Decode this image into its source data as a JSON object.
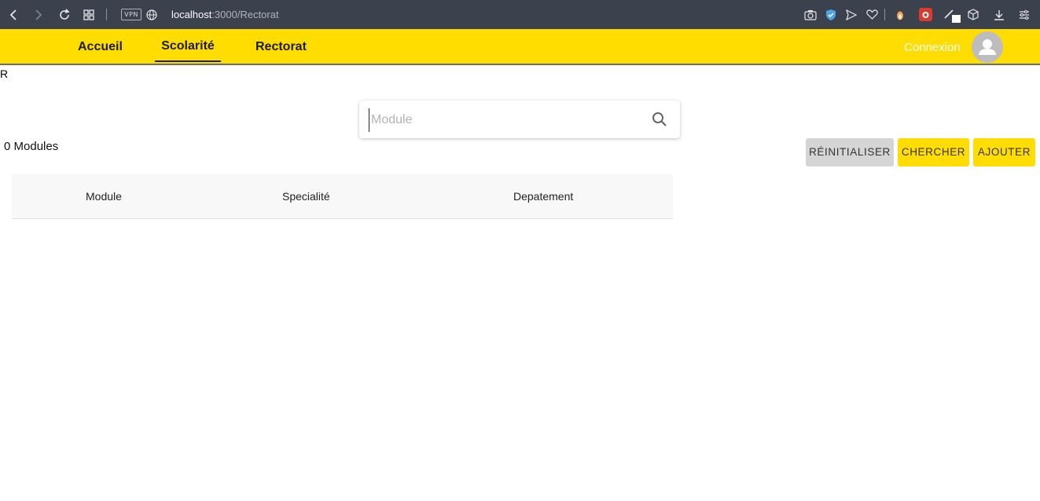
{
  "browser": {
    "vpn_label": "VPN",
    "url_host": "localhost",
    "url_rest": ":3000/Rectorat"
  },
  "nav": {
    "links": [
      "Accueil",
      "Scolarité",
      "Rectorat"
    ],
    "active": "Scolarité",
    "login_label": "Connexion"
  },
  "page": {
    "stray_text": "R",
    "search_placeholder": "Module",
    "count_text": "0 Modules",
    "buttons": {
      "reset": "RÉINITIALISER",
      "search": "CHERCHER",
      "add": "AJOUTER"
    }
  },
  "table": {
    "columns": [
      "Module",
      "Specialité",
      "Depatement"
    ],
    "rows": []
  },
  "colors": {
    "nav_background": "#ffdd00",
    "browser_bar": "#3b414d",
    "reset_button": "#d5d5d5",
    "primary_button": "#ffdd00"
  }
}
